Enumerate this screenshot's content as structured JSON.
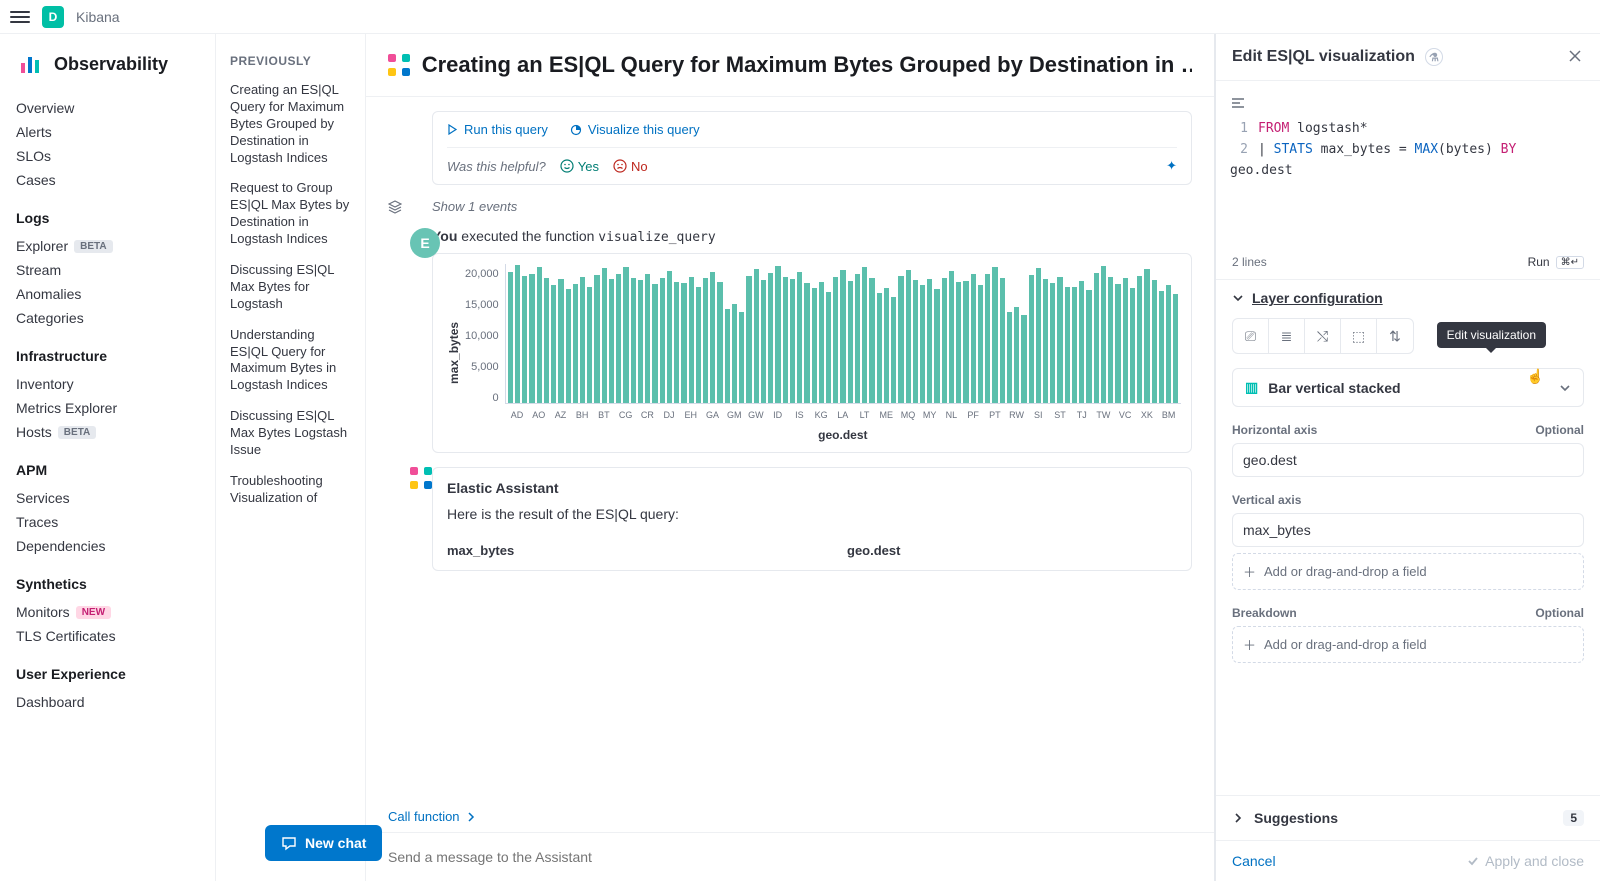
{
  "topbar": {
    "logo_letter": "D",
    "breadcrumb": "Kibana"
  },
  "leftnav": {
    "title": "Observability",
    "top_items": [
      "Overview",
      "Alerts",
      "SLOs",
      "Cases"
    ],
    "groups": [
      {
        "title": "Logs",
        "items": [
          {
            "label": "Explorer",
            "badge": "BETA",
            "badge_type": "beta"
          },
          {
            "label": "Stream"
          },
          {
            "label": "Anomalies"
          },
          {
            "label": "Categories"
          }
        ]
      },
      {
        "title": "Infrastructure",
        "items": [
          {
            "label": "Inventory"
          },
          {
            "label": "Metrics Explorer"
          },
          {
            "label": "Hosts",
            "badge": "BETA",
            "badge_type": "beta"
          }
        ]
      },
      {
        "title": "APM",
        "items": [
          {
            "label": "Services"
          },
          {
            "label": "Traces"
          },
          {
            "label": "Dependencies"
          }
        ]
      },
      {
        "title": "Synthetics",
        "items": [
          {
            "label": "Monitors",
            "badge": "NEW",
            "badge_type": "new"
          },
          {
            "label": "TLS Certificates"
          }
        ]
      },
      {
        "title": "User Experience",
        "items": [
          {
            "label": "Dashboard"
          }
        ]
      }
    ]
  },
  "history": {
    "heading": "PREVIOUSLY",
    "items": [
      "Creating an ES|QL Query for Maximum Bytes Grouped by Destination in Logstash Indices",
      "Request to Group ES|QL Max Bytes by Destination in Logstash Indices",
      "Discussing ES|QL Max Bytes for Logstash",
      "Understanding ES|QL Query for Maximum Bytes in Logstash Indices",
      "Discussing ES|QL Max Bytes Logstash Issue",
      "Troubleshooting Visualization of"
    ],
    "new_chat": "New chat"
  },
  "main": {
    "title": "Creating an ES|QL Query for Maximum Bytes Grouped by Destination in …",
    "run_query": "Run this query",
    "visualize_query": "Visualize this query",
    "feedback_q": "Was this helpful?",
    "yes": "Yes",
    "no": "No",
    "show_events": "Show 1 events",
    "you": "You",
    "you_text": " executed the function ",
    "you_fn": "visualize_query",
    "assistant_name": "Elastic Assistant",
    "assistant_text": "Here is the result of the ES|QL query:",
    "col1": "max_bytes",
    "col2": "geo.dest",
    "call_fn": "Call function",
    "input_placeholder": "Send a message to the Assistant"
  },
  "rightpanel": {
    "title": "Edit ES|QL visualization",
    "code_lines_info": "2 lines",
    "run": "Run",
    "tooltip": "Edit visualization",
    "layer_title": "Layer configuration",
    "chart_type": "Bar vertical stacked",
    "h_axis": "Horizontal axis",
    "optional": "Optional",
    "h_field": "geo.dest",
    "v_axis": "Vertical axis",
    "v_field": "max_bytes",
    "breakdown": "Breakdown",
    "add_field": "Add or drag-and-drop a field",
    "suggestions": "Suggestions",
    "suggestions_count": "5",
    "cancel": "Cancel",
    "apply": "Apply and close",
    "code": {
      "l1_kw": "FROM",
      "l1_rest": " logstash*",
      "l2_pipe": "| ",
      "l2_stats": "STATS",
      "l2_mid": " max_bytes = ",
      "l2_fn": "MAX",
      "l2_args": "(bytes) ",
      "l2_by": "BY",
      "l2_end": " geo.dest"
    }
  },
  "chart_data": {
    "type": "bar",
    "title": "",
    "xlabel": "geo.dest",
    "ylabel": "max_bytes",
    "ylim": [
      0,
      20000
    ],
    "yticks": [
      0,
      5000,
      10000,
      15000,
      20000
    ],
    "categories": [
      "AD",
      "AO",
      "AZ",
      "BH",
      "BT",
      "CG",
      "CR",
      "DJ",
      "EH",
      "GA",
      "GM",
      "GW",
      "ID",
      "IS",
      "KG",
      "LA",
      "LT",
      "ME",
      "MQ",
      "MY",
      "NL",
      "PF",
      "PT",
      "RW",
      "SI",
      "ST",
      "TJ",
      "TW",
      "VC",
      "XK",
      "BM"
    ],
    "values": [
      19800,
      19500,
      17800,
      18100,
      19400,
      19600,
      18600,
      19000,
      18200,
      18900,
      14200,
      19300,
      19700,
      18800,
      17400,
      19100,
      19500,
      16600,
      19200,
      17900,
      19000,
      18500,
      19600,
      13800,
      19400,
      18200,
      17600,
      19700,
      18000,
      19300,
      17000
    ]
  }
}
